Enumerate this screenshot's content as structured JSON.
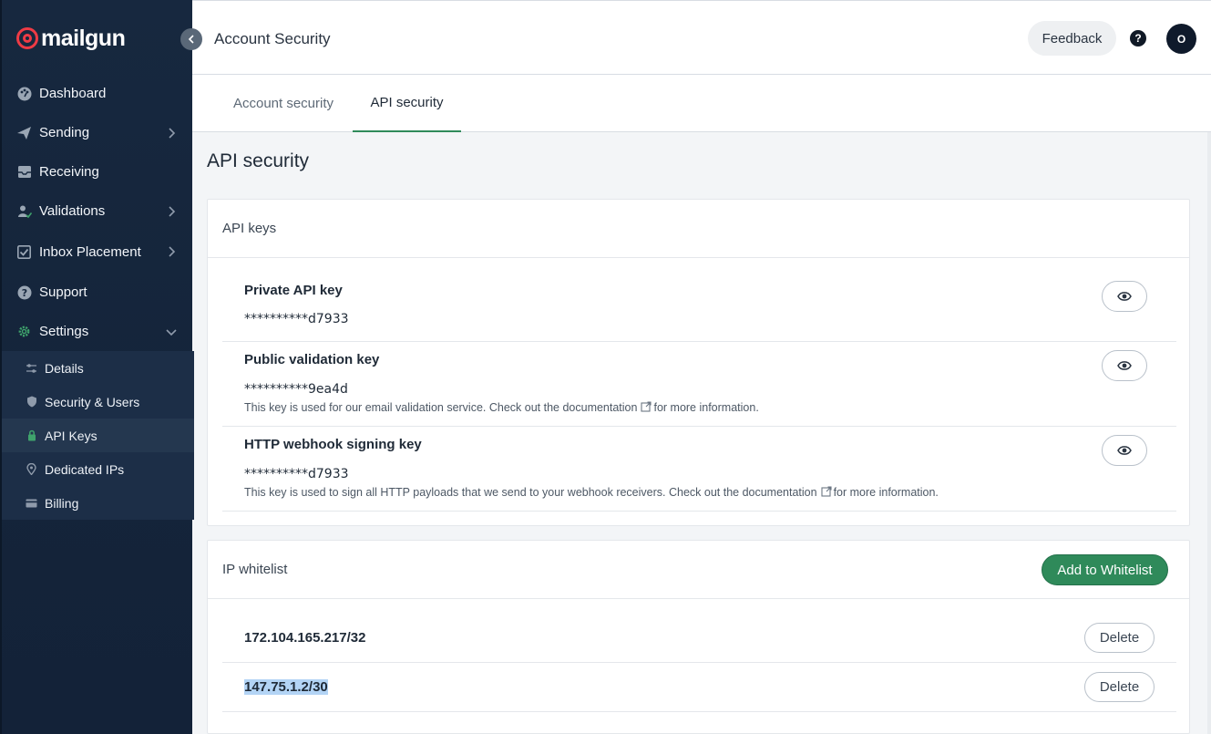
{
  "brand": {
    "name": "mailgun",
    "accent": "#ef3b45"
  },
  "sidebar": {
    "collapse_icon": "chevron-left-icon",
    "items": [
      {
        "label": "Dashboard",
        "icon": "dashboard-icon",
        "has_chevron": false
      },
      {
        "label": "Sending",
        "icon": "send-icon",
        "has_chevron": true
      },
      {
        "label": "Receiving",
        "icon": "inbox-icon",
        "has_chevron": false
      },
      {
        "label": "Validations",
        "icon": "validation-icon",
        "has_chevron": true
      },
      {
        "label": "Inbox Placement",
        "icon": "checkbox-icon",
        "has_chevron": true
      },
      {
        "label": "Support",
        "icon": "help-icon",
        "has_chevron": false
      },
      {
        "label": "Settings",
        "icon": "gear-icon",
        "has_chevron": true,
        "expanded": true
      }
    ],
    "sub_items": [
      {
        "label": "Details",
        "icon": "sliders-icon"
      },
      {
        "label": "Security & Users",
        "icon": "shield-icon"
      },
      {
        "label": "API Keys",
        "icon": "lock-icon",
        "active": true
      },
      {
        "label": "Dedicated IPs",
        "icon": "location-pin-icon"
      },
      {
        "label": "Billing",
        "icon": "credit-card-icon"
      }
    ]
  },
  "header": {
    "title": "Account Security",
    "feedback_label": "Feedback",
    "help_label": "?",
    "avatar_initial": "O"
  },
  "tabs": [
    {
      "label": "Account security",
      "active": false
    },
    {
      "label": "API security",
      "active": true
    }
  ],
  "main": {
    "title": "API security",
    "api_keys": {
      "heading": "API keys",
      "keys": [
        {
          "name": "Private API key",
          "masked_value": "**********d7933",
          "description": ""
        },
        {
          "name": "Public validation key",
          "masked_value": "**********9ea4d",
          "description_before": "This key is used for our email validation service. Check out the documentation",
          "description_after": "for more information."
        },
        {
          "name": "HTTP webhook signing key",
          "masked_value": "**********d7933",
          "description_before": "This key is used to sign all HTTP payloads that we send to your webhook receivers. Check out the documentation",
          "description_after": "for more information."
        }
      ]
    },
    "ip_whitelist": {
      "heading": "IP whitelist",
      "add_label": "Add to Whitelist",
      "entries": [
        {
          "ip": "172.104.165.217/32",
          "delete_label": "Delete",
          "selected": false
        },
        {
          "ip": "147.75.1.2/30",
          "delete_label": "Delete",
          "selected": true
        }
      ]
    }
  },
  "colors": {
    "primary_green": "#2f8a5a",
    "sidebar_bg": "#17283f"
  }
}
